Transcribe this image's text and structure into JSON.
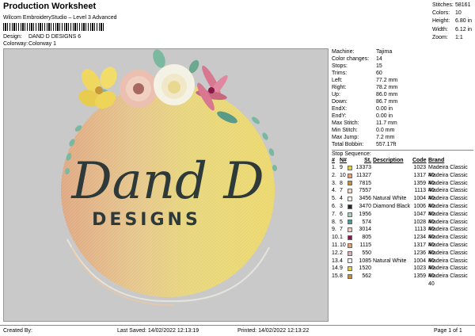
{
  "header": {
    "title": "Production Worksheet",
    "subtitle": "Wilcom EmbroideryStudio – Level 3 Advanced",
    "design_label": "Design:",
    "design_value": "DAND D DESIGNS 6",
    "colorway_label": "Colorway:",
    "colorway_value": "Colorway 1"
  },
  "summary": [
    {
      "k": "Stitches:",
      "v": "58161"
    },
    {
      "k": "Colors:",
      "v": "10"
    },
    {
      "k": "Height:",
      "v": "6.80 in"
    },
    {
      "k": "Width:",
      "v": "6.12 in"
    },
    {
      "k": "Zoom:",
      "v": "1:1"
    }
  ],
  "machine_info": [
    {
      "k": "Machine:",
      "v": "Tajima"
    },
    {
      "k": "Color changes:",
      "v": "14"
    },
    {
      "k": "Stops:",
      "v": "15"
    },
    {
      "k": "Trims:",
      "v": "60"
    },
    {
      "k": "Left:",
      "v": "77.2 mm"
    },
    {
      "k": "Right:",
      "v": "78.2 mm"
    },
    {
      "k": "Up:",
      "v": "86.0 mm"
    },
    {
      "k": "Down:",
      "v": "86.7 mm"
    },
    {
      "k": "EndX:",
      "v": "0.00 in"
    },
    {
      "k": "EndY:",
      "v": "0.00 in"
    },
    {
      "k": "Max Stitch:",
      "v": "11.7 mm"
    },
    {
      "k": "Min Stitch:",
      "v": "0.0 mm"
    },
    {
      "k": "Max Jump:",
      "v": "7.2 mm"
    },
    {
      "k": "Total Bobbin:",
      "v": "557.17ft"
    }
  ],
  "stop_sequence": {
    "label": "Stop Sequence:",
    "headers": [
      "#",
      "N#",
      "St.",
      "Description",
      "Code",
      "Brand"
    ],
    "rows": [
      {
        "n": "1.",
        "nn": "9",
        "color": "#e8d23c",
        "st": "13373",
        "desc": "",
        "code": "1023",
        "brand": "Madeira Classic 40"
      },
      {
        "n": "2.",
        "nn": "10",
        "color": "#e8a070",
        "st": "11327",
        "desc": "",
        "code": "1317",
        "brand": "Madeira Classic 40"
      },
      {
        "n": "3.",
        "nn": "8",
        "color": "#c49040",
        "st": "7815",
        "desc": "",
        "code": "1359",
        "brand": "Madeira Classic 40"
      },
      {
        "n": "4.",
        "nn": "7",
        "color": "#f0d8c8",
        "st": "7557",
        "desc": "",
        "code": "1113",
        "brand": "Madeira Classic 40"
      },
      {
        "n": "5.",
        "nn": "4",
        "color": "#f4f4ee",
        "st": "3456",
        "desc": "Natural White",
        "code": "1004",
        "brand": "Madeira Classic 40"
      },
      {
        "n": "6.",
        "nn": "3",
        "color": "#2a2a2a",
        "st": "3470",
        "desc": "Diamond Black",
        "code": "1006",
        "brand": "Madeira Classic 40"
      },
      {
        "n": "7.",
        "nn": "6",
        "color": "#a8d0b4",
        "st": "1956",
        "desc": "",
        "code": "1047",
        "brand": "Madeira Classic 40"
      },
      {
        "n": "8.",
        "nn": "5",
        "color": "#4a9a98",
        "st": "574",
        "desc": "",
        "code": "1028",
        "brand": "Madeira Classic 40"
      },
      {
        "n": "9.",
        "nn": "7",
        "color": "#f0c8c0",
        "st": "3014",
        "desc": "",
        "code": "1113",
        "brand": "Madeira Classic 40"
      },
      {
        "n": "10.",
        "nn": "1",
        "color": "#8a1848",
        "st": "805",
        "desc": "",
        "code": "1234",
        "brand": "Madeira Classic 40"
      },
      {
        "n": "11.",
        "nn": "10",
        "color": "#e0a070",
        "st": "1115",
        "desc": "",
        "code": "1317",
        "brand": "Madeira Classic 40"
      },
      {
        "n": "12.",
        "nn": "2",
        "color": "#d8b0b8",
        "st": "550",
        "desc": "",
        "code": "1236",
        "brand": "Madeira Classic 40"
      },
      {
        "n": "13.",
        "nn": "4",
        "color": "#f4f4ee",
        "st": "1085",
        "desc": "Natural White",
        "code": "1004",
        "brand": "Madeira Classic 40"
      },
      {
        "n": "14.",
        "nn": "9",
        "color": "#e8d23c",
        "st": "1520",
        "desc": "",
        "code": "1023",
        "brand": "Madeira Classic 40"
      },
      {
        "n": "15.",
        "nn": "8",
        "color": "#c49040",
        "st": "562",
        "desc": "",
        "code": "1359",
        "brand": "Madeira Classic 40"
      }
    ]
  },
  "design_text": {
    "line1": "Dand D",
    "line2": "DESIGNS"
  },
  "footer": {
    "created_by": "Created By:",
    "last_saved": "Last Saved:  14/02/2022 12:13:19",
    "printed": "Printed:  14/02/2022 12:13:22",
    "page": "Page 1 of 1"
  }
}
